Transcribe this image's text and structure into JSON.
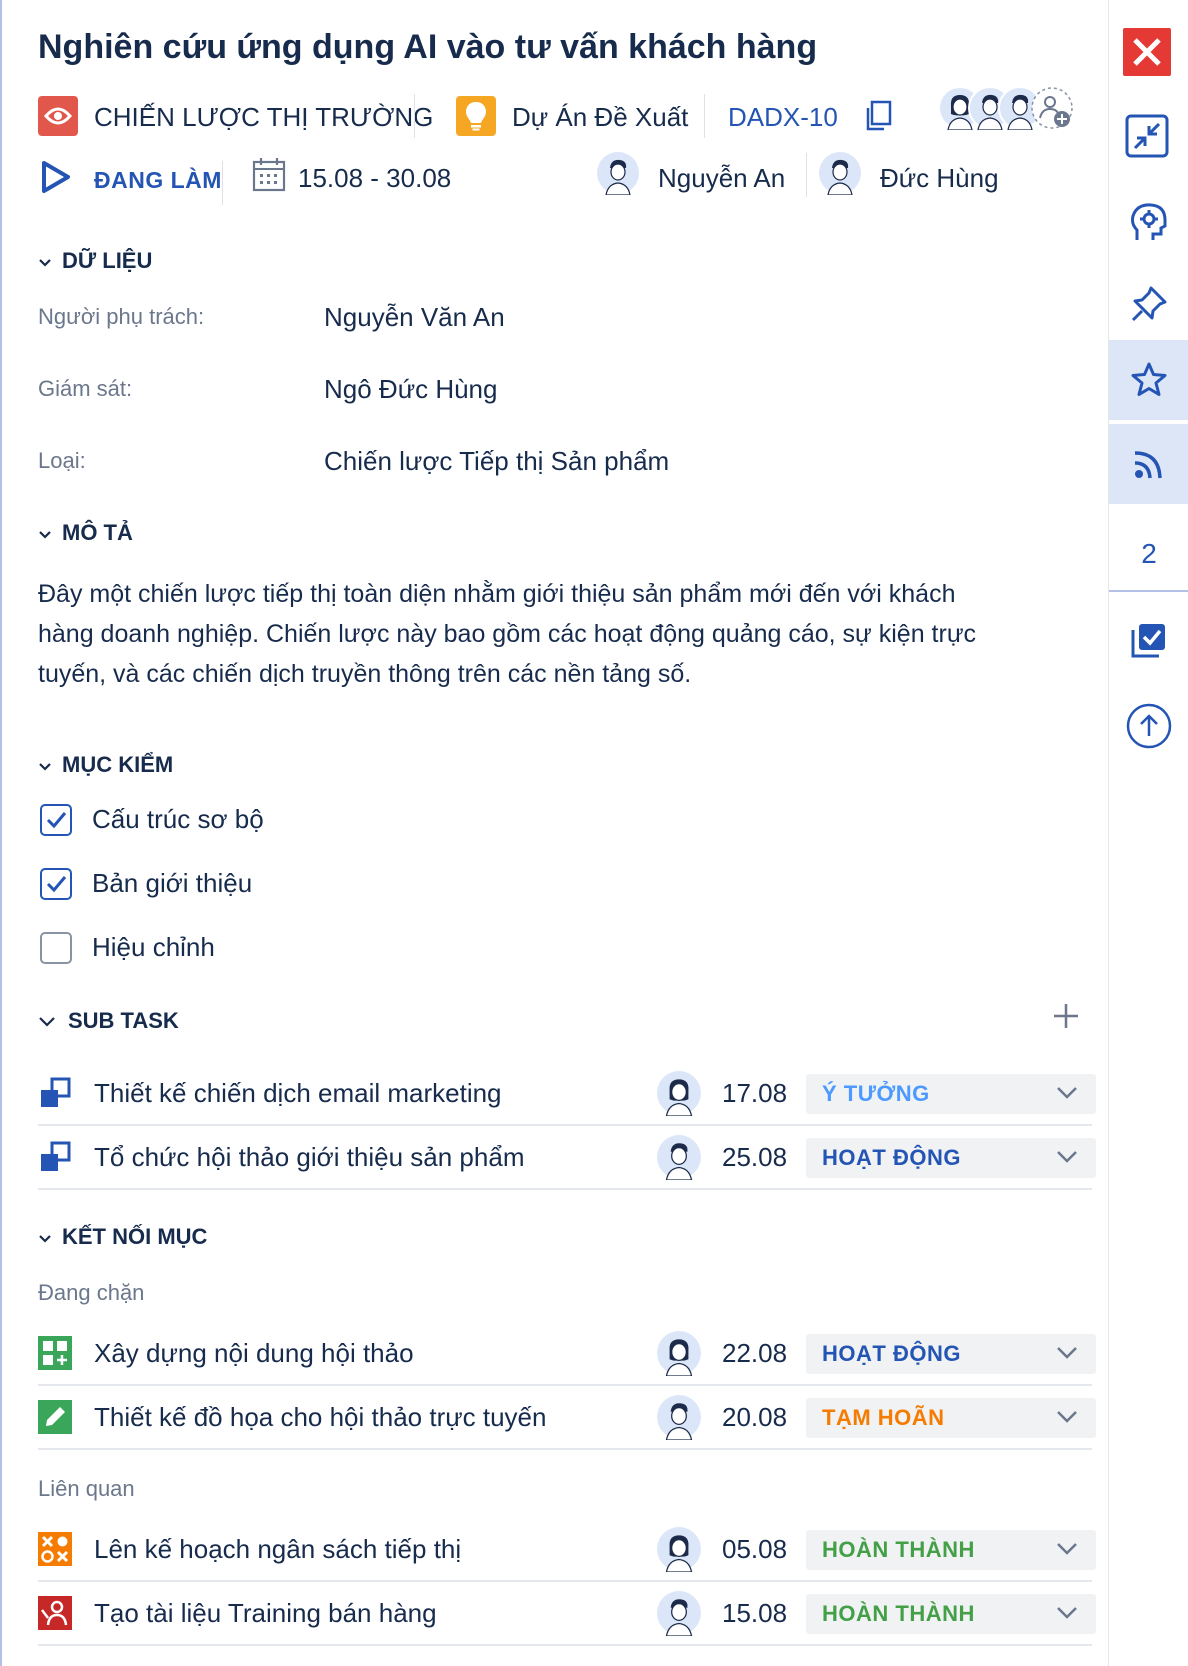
{
  "title": "Nghiên cứu ứng dụng AI vào tư vấn khách hàng",
  "meta": {
    "category": "CHIẾN LƯỢC THỊ TRƯỜNG",
    "project": "Dự Án Đề Xuất",
    "issue_key": "DADX-10",
    "status": "ĐANG LÀM",
    "date_range": "15.08 - 30.08",
    "assignee_short": "Nguyễn An",
    "reviewer_short": "Đức Hùng"
  },
  "data_section": {
    "heading": "DỮ LIỆU",
    "fields": [
      {
        "label": "Người phụ trách:",
        "value": "Nguyễn Văn An"
      },
      {
        "label": "Giám sát:",
        "value": "Ngô Đức Hùng"
      },
      {
        "label": "Loại:",
        "value": "Chiến lược Tiếp thị Sản phẩm"
      }
    ]
  },
  "description": {
    "heading": "MÔ TẢ",
    "lines": [
      "Đây một chiến lược tiếp thị toàn diện nhằm giới thiệu sản phẩm mới đến với khách",
      "hàng doanh nghiệp. Chiến lược này bao gồm các hoạt động quảng cáo, sự kiện trực",
      "tuyến, và các chiến dịch truyền thông trên các nền tảng số."
    ]
  },
  "checklist": {
    "heading": "MỤC KIỂM",
    "items": [
      {
        "label": "Cấu trúc sơ bộ",
        "checked": true
      },
      {
        "label": "Bản giới thiệu",
        "checked": true
      },
      {
        "label": "Hiệu chỉnh",
        "checked": false
      }
    ]
  },
  "subtasks": {
    "heading": "SUB TASK",
    "items": [
      {
        "label": "Thiết kế chiến dịch email marketing",
        "date": "17.08",
        "status": "Ý TƯỞNG",
        "status_color": "#4c9aff"
      },
      {
        "label": "Tổ chức hội thảo giới thiệu sản phẩm",
        "date": "25.08",
        "status": "HOẠT ĐỘNG",
        "status_color": "#2455b5"
      }
    ]
  },
  "links": {
    "heading": "KẾT NỐI MỤC",
    "blocking_label": "Đang chặn",
    "blocking": [
      {
        "label": "Xây dựng nội dung hội thảo",
        "date": "22.08",
        "status": "HOẠT ĐỘNG",
        "status_color": "#2455b5",
        "icon": "grid-icon"
      },
      {
        "label": "Thiết kế đồ họa cho hội thảo trực tuyến",
        "date": "20.08",
        "status": "TẠM HOÃN",
        "status_color": "#f57c00",
        "icon": "pencil-icon"
      }
    ],
    "related_label": "Liên quan",
    "related": [
      {
        "label": " Lên kế hoạch ngân sách tiếp thị",
        "date": "05.08",
        "status": "HOÀN THÀNH",
        "status_color": "#43a047",
        "icon": "shapes-icon"
      },
      {
        "label": "Tạo tài liệu Training bán hàng",
        "date": "15.08",
        "status": "HOÀN THÀNH",
        "status_color": "#43a047",
        "icon": "presentation-icon"
      }
    ]
  },
  "rail": {
    "comment_count": "2"
  },
  "colors": {
    "accent": "#2455b5",
    "category_badge": "#e2574c",
    "project_badge": "#f5a623",
    "close": "#e53935"
  }
}
